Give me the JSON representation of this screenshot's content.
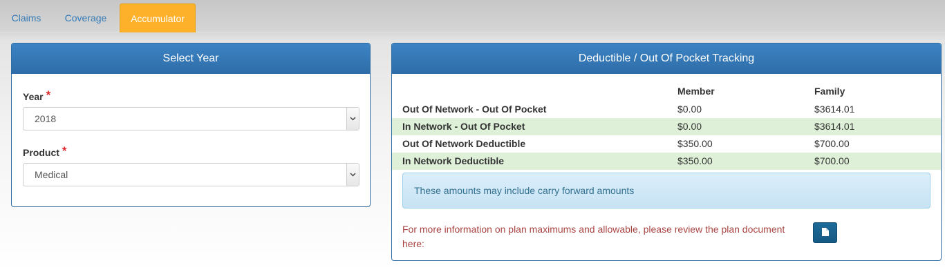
{
  "tabs": [
    {
      "label": "Claims"
    },
    {
      "label": "Coverage"
    },
    {
      "label": "Accumulator"
    }
  ],
  "select_year_panel": {
    "title": "Select Year",
    "year_label": "Year",
    "year_value": "2018",
    "product_label": "Product",
    "product_value": "Medical",
    "required_mark": "*"
  },
  "tracking_panel": {
    "title": "Deductible / Out Of Pocket Tracking",
    "columns": [
      "",
      "Member",
      "Family"
    ],
    "rows": [
      {
        "label": "Out Of Network - Out Of Pocket",
        "member": "$0.00",
        "family": "$3614.01"
      },
      {
        "label": "In Network - Out Of Pocket",
        "member": "$0.00",
        "family": "$3614.01"
      },
      {
        "label": "Out Of Network Deductible",
        "member": "$350.00",
        "family": "$700.00"
      },
      {
        "label": "In Network Deductible",
        "member": "$350.00",
        "family": "$700.00"
      }
    ],
    "alert": "These amounts may include carry forward amounts",
    "info_text": "For more information on plan maximums and allowable, please review the plan document here:",
    "doc_button_icon": "file-icon"
  },
  "colors": {
    "accent_tab": "#fdb02a",
    "panel_header": "#337ab7",
    "row_highlight": "#dff0d8",
    "info_text": "#a94442"
  }
}
